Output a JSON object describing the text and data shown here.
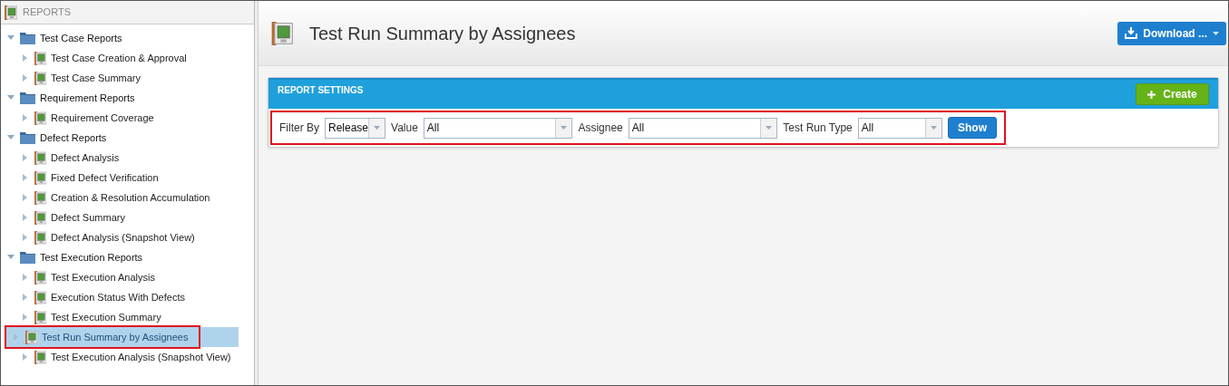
{
  "sidebar": {
    "title": "REPORTS",
    "tree": [
      {
        "label": "Test Case Reports",
        "kind": "folder",
        "expanded": true,
        "children": [
          {
            "label": "Test Case Creation & Approval",
            "kind": "report",
            "expanded": false,
            "selected": false,
            "highlighted": false
          },
          {
            "label": "Test Case Summary",
            "kind": "report",
            "expanded": false,
            "selected": false,
            "highlighted": false
          }
        ]
      },
      {
        "label": "Requirement Reports",
        "kind": "folder",
        "expanded": true,
        "children": [
          {
            "label": "Requirement Coverage",
            "kind": "report",
            "expanded": false,
            "selected": false,
            "highlighted": false
          }
        ]
      },
      {
        "label": "Defect Reports",
        "kind": "folder",
        "expanded": true,
        "children": [
          {
            "label": "Defect Analysis",
            "kind": "report",
            "expanded": false,
            "selected": false,
            "highlighted": false
          },
          {
            "label": "Fixed Defect Verification",
            "kind": "report",
            "expanded": false,
            "selected": false,
            "highlighted": false
          },
          {
            "label": "Creation & Resolution Accumulation",
            "kind": "report",
            "expanded": false,
            "selected": false,
            "highlighted": false
          },
          {
            "label": "Defect Summary",
            "kind": "report",
            "expanded": false,
            "selected": false,
            "highlighted": false
          },
          {
            "label": "Defect Analysis (Snapshot View)",
            "kind": "report",
            "expanded": false,
            "selected": false,
            "highlighted": false
          }
        ]
      },
      {
        "label": "Test Execution Reports",
        "kind": "folder",
        "expanded": true,
        "children": [
          {
            "label": "Test Execution Analysis",
            "kind": "report",
            "expanded": false,
            "selected": false,
            "highlighted": false
          },
          {
            "label": "Execution Status With Defects",
            "kind": "report",
            "expanded": false,
            "selected": false,
            "highlighted": false
          },
          {
            "label": "Test Execution Summary",
            "kind": "report",
            "expanded": false,
            "selected": false,
            "highlighted": false
          },
          {
            "label": "Test Run Summary by Assignees",
            "kind": "report",
            "expanded": false,
            "selected": true,
            "highlighted": true
          },
          {
            "label": "Test Execution Analysis (Snapshot View)",
            "kind": "report",
            "expanded": false,
            "selected": false,
            "highlighted": false
          }
        ]
      }
    ]
  },
  "header": {
    "title": "Test Run Summary by Assignees",
    "download_button": "Download ..."
  },
  "settings_panel": {
    "title": "REPORT SETTINGS",
    "create_button": "Create",
    "highlighted": true,
    "filters": [
      {
        "label": "Filter By",
        "value": "Release"
      },
      {
        "label": "Value",
        "value": "All"
      },
      {
        "label": "Assignee",
        "value": "All"
      },
      {
        "label": "Test Run Type",
        "value": "All"
      }
    ],
    "show_button": "Show"
  }
}
